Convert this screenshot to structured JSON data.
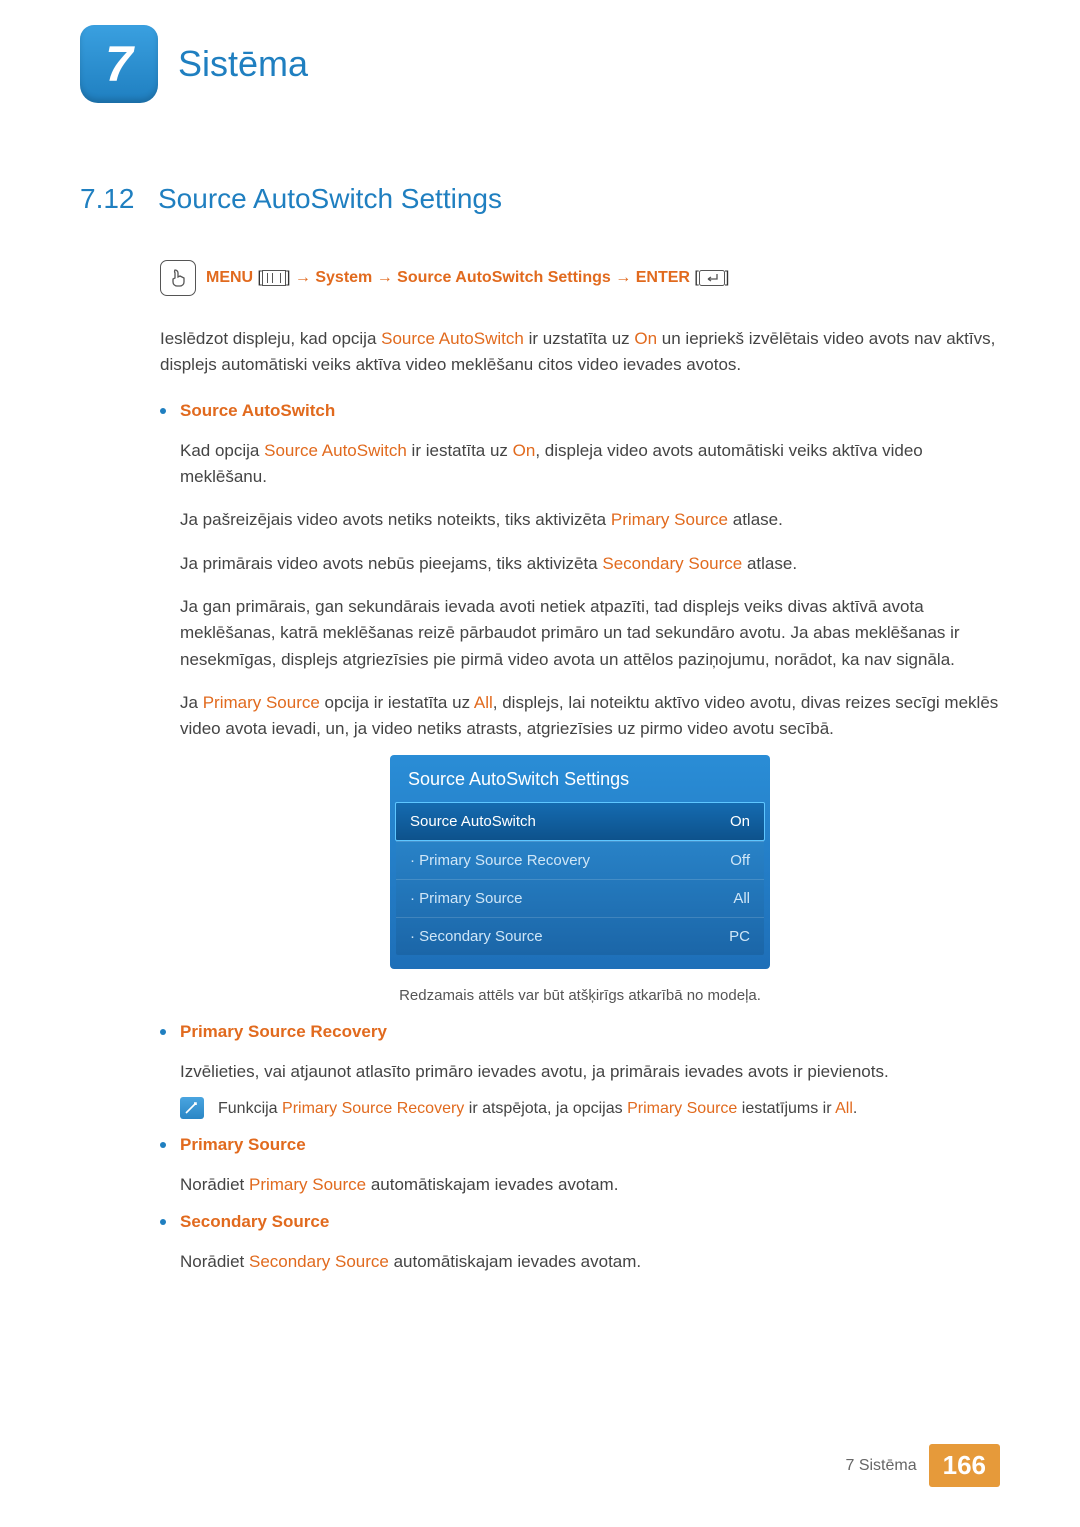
{
  "chapter": {
    "number": "7",
    "title": "Sistēma"
  },
  "section": {
    "number": "7.12",
    "title": "Source AutoSwitch Settings"
  },
  "nav": {
    "menu": "MENU",
    "arrow": "→",
    "system": "System",
    "sass": "Source AutoSwitch Settings",
    "enter": "ENTER"
  },
  "intro": {
    "p1a": "Ieslēdzot displeju, kad opcija ",
    "p1b": "Source AutoSwitch",
    "p1c": " ir uzstatīta uz ",
    "p1d": "On",
    "p1e": " un iepriekš izvēlētais video avots nav aktīvs, displejs automātiski veiks aktīva video meklēšanu citos video ievades avotos."
  },
  "bullets": {
    "sas_title": "Source AutoSwitch",
    "sas_p1a": "Kad opcija ",
    "sas_p1b": "Source AutoSwitch",
    "sas_p1c": " ir iestatīta uz ",
    "sas_p1d": "On",
    "sas_p1e": ", displeja video avots automātiski veiks aktīva video meklēšanu.",
    "sas_p2a": "Ja pašreizējais video avots netiks noteikts, tiks aktivizēta ",
    "sas_p2b": "Primary Source",
    "sas_p2c": " atlase.",
    "sas_p3a": "Ja primārais video avots nebūs pieejams, tiks aktivizēta ",
    "sas_p3b": "Secondary Source",
    "sas_p3c": " atlase.",
    "sas_p4": "Ja gan primārais, gan sekundārais ievada avoti netiek atpazīti, tad displejs veiks divas aktīvā avota meklēšanas, katrā meklēšanas reizē pārbaudot primāro un tad sekundāro avotu. Ja abas meklēšanas ir nesekmīgas, displejs atgriezīsies pie pirmā video avota un attēlos paziņojumu, norādot, ka nav signāla.",
    "sas_p5a": "Ja ",
    "sas_p5b": "Primary Source",
    "sas_p5c": " opcija ir iestatīta uz ",
    "sas_p5d": "All",
    "sas_p5e": ", displejs, lai noteiktu aktīvo video avotu, divas reizes secīgi meklēs video avota ievadi, un, ja video netiks atrasts, atgriezīsies uz pirmo video avotu secībā.",
    "psr_title": "Primary Source Recovery",
    "psr_p1": "Izvēlieties, vai atjaunot atlasīto primāro ievades avotu, ja primārais ievades avots ir pievienots.",
    "psr_note_a": "Funkcija ",
    "psr_note_b": "Primary Source Recovery",
    "psr_note_c": " ir atspējota, ja opcijas ",
    "psr_note_d": "Primary Source",
    "psr_note_e": " iestatījums ir ",
    "psr_note_f": "All",
    "psr_note_g": ".",
    "ps_title": "Primary Source",
    "ps_p1a": "Norādiet ",
    "ps_p1b": "Primary Source",
    "ps_p1c": " automātiskajam ievades avotam.",
    "ss_title": "Secondary Source",
    "ss_p1a": "Norādiet ",
    "ss_p1b": "Secondary Source",
    "ss_p1c": " automātiskajam ievades avotam."
  },
  "menu_panel": {
    "title": "Source AutoSwitch Settings",
    "rows": [
      {
        "prefix": "",
        "label": "Source AutoSwitch",
        "value": "On",
        "selected": true
      },
      {
        "prefix": "·",
        "label": "Primary Source Recovery",
        "value": "Off",
        "selected": false
      },
      {
        "prefix": "·",
        "label": "Primary Source",
        "value": "All",
        "selected": false
      },
      {
        "prefix": "·",
        "label": "Secondary Source",
        "value": "PC",
        "selected": false
      }
    ],
    "caption": "Redzamais attēls var būt atšķirīgs atkarībā no modeļa."
  },
  "footer": {
    "text": "7 Sistēma",
    "page": "166"
  }
}
